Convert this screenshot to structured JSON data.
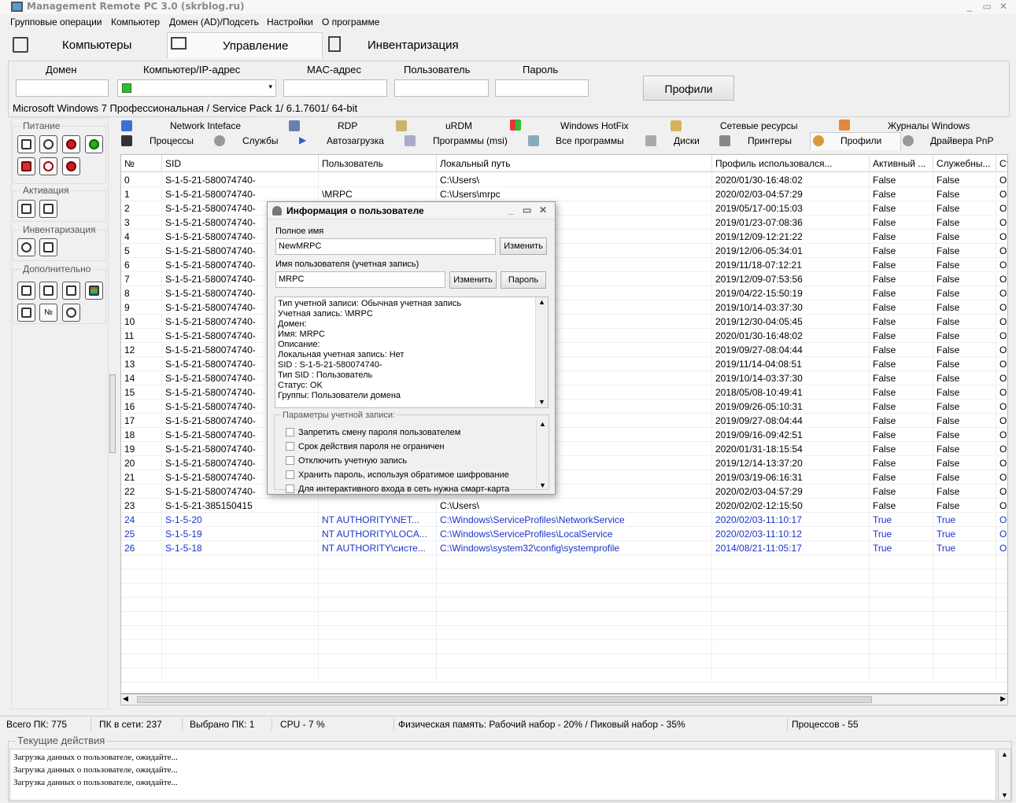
{
  "window": {
    "title": "Management Remote PC 3.0 (skrblog.ru)",
    "min": "_",
    "max": "▭",
    "close": "✕"
  },
  "menu": [
    "Групповые операции",
    "Компьютер",
    "Домен (AD)/Подсеть",
    "Настройки",
    "О программе"
  ],
  "tabs": [
    "Компьютеры",
    "Управление",
    "Инвентаризация"
  ],
  "fields": {
    "domain_label": "Домен",
    "host_label": "Компьютер/IP-адрес",
    "mac_label": "MAC-адрес",
    "user_label": "Пользователь",
    "password_label": "Пароль",
    "profiles_button": "Профили"
  },
  "os_info": "Microsoft Windows 7 Профессиональная / Service Pack 1/ 6.1.7601/ 64-bit",
  "left_groups": {
    "power": "Питание",
    "activation": "Активация",
    "inventory": "Инвентаризация",
    "extra": "Дополнительно"
  },
  "subtabs_row1": [
    "Network Inteface",
    "RDP",
    "uRDM",
    "Windows HotFix",
    "Сетевые ресурсы",
    "Журналы Windows"
  ],
  "subtabs_row2": [
    "Процессы",
    "Службы",
    "Автозагрузка",
    "Программы (msi)",
    "Все программы",
    "Диски",
    "Принтеры",
    "Профили",
    "Драйвера PnP"
  ],
  "grid": {
    "headers": [
      "№",
      "SID",
      "Пользователь",
      "Локальный путь",
      "Профиль использовался...",
      "Активный ...",
      "Служебны...",
      "Ст"
    ],
    "rows": [
      [
        "0",
        "S-1-5-21-580074740-",
        "",
        "C:\\Users\\",
        "2020/01/30-16:48:02",
        "False",
        "False",
        "O"
      ],
      [
        "1",
        "S-1-5-21-580074740-",
        "\\MRPC",
        "C:\\Users\\mrpc",
        "2020/02/03-04:57:29",
        "False",
        "False",
        "O"
      ],
      [
        "2",
        "S-1-5-21-580074740-",
        "",
        "",
        "2019/05/17-00:15:03",
        "False",
        "False",
        "O"
      ],
      [
        "3",
        "S-1-5-21-580074740-",
        "",
        "ла",
        "2019/01/23-07:08:36",
        "False",
        "False",
        "O"
      ],
      [
        "4",
        "S-1-5-21-580074740-",
        "",
        "ав",
        "2019/12/09-12:21:22",
        "False",
        "False",
        "O"
      ],
      [
        "5",
        "S-1-5-21-580074740-",
        "",
        "рий",
        "2019/12/06-05:34:01",
        "False",
        "False",
        "O"
      ],
      [
        "6",
        "S-1-5-21-580074740-",
        "",
        "",
        "2019/11/18-07:12:21",
        "False",
        "False",
        "O"
      ],
      [
        "7",
        "S-1-5-21-580074740-",
        "",
        "рия",
        "2019/12/09-07:53:56",
        "False",
        "False",
        "O"
      ],
      [
        "8",
        "S-1-5-21-580074740-",
        "",
        "",
        "2019/04/22-15:50:19",
        "False",
        "False",
        "O"
      ],
      [
        "9",
        "S-1-5-21-580074740-",
        "",
        "",
        "2019/10/14-03:37:30",
        "False",
        "False",
        "O"
      ],
      [
        "10",
        "S-1-5-21-580074740-",
        "",
        "",
        "2019/12/30-04:05:45",
        "False",
        "False",
        "O"
      ],
      [
        "11",
        "S-1-5-21-580074740-",
        "",
        "рия",
        "2020/01/30-16:48:02",
        "False",
        "False",
        "O"
      ],
      [
        "12",
        "S-1-5-21-580074740-",
        "",
        "",
        "2019/09/27-08:04:44",
        "False",
        "False",
        "O"
      ],
      [
        "13",
        "S-1-5-21-580074740-",
        "",
        "",
        "2019/11/14-04:08:51",
        "False",
        "False",
        "O"
      ],
      [
        "14",
        "S-1-5-21-580074740-",
        "",
        "",
        "2019/10/14-03:37:30",
        "False",
        "False",
        "O"
      ],
      [
        "15",
        "S-1-5-21-580074740-",
        "",
        "",
        "2018/05/08-10:49:41",
        "False",
        "False",
        "O"
      ],
      [
        "16",
        "S-1-5-21-580074740-",
        "",
        "",
        "2019/09/26-05:10:31",
        "False",
        "False",
        "O"
      ],
      [
        "17",
        "S-1-5-21-580074740-",
        "",
        "й",
        "2019/09/27-08:04:44",
        "False",
        "False",
        "O"
      ],
      [
        "18",
        "S-1-5-21-580074740-",
        "",
        "др",
        "2019/09/16-09:42:51",
        "False",
        "False",
        "O"
      ],
      [
        "19",
        "S-1-5-21-580074740-",
        "",
        "",
        "2020/01/31-18:15:54",
        "False",
        "False",
        "O"
      ],
      [
        "20",
        "S-1-5-21-580074740-",
        "",
        "",
        "2019/12/14-13:37:20",
        "False",
        "False",
        "O"
      ],
      [
        "21",
        "S-1-5-21-580074740-",
        "",
        "",
        "2019/03/19-06:16:31",
        "False",
        "False",
        "O"
      ],
      [
        "22",
        "S-1-5-21-580074740-",
        "",
        "",
        "2020/02/03-04:57:29",
        "False",
        "False",
        "O"
      ],
      [
        "23",
        "S-1-5-21-385150415",
        "",
        "C:\\Users\\",
        "2020/02/02-12:15:50",
        "False",
        "False",
        "O"
      ]
    ],
    "sys_rows": [
      [
        "24",
        "S-1-5-20",
        "NT AUTHORITY\\NET...",
        "C:\\Windows\\ServiceProfiles\\NetworkService",
        "2020/02/03-11:10:17",
        "True",
        "True",
        "O"
      ],
      [
        "25",
        "S-1-5-19",
        "NT AUTHORITY\\LOCA...",
        "C:\\Windows\\ServiceProfiles\\LocalService",
        "2020/02/03-11:10:12",
        "True",
        "True",
        "O"
      ],
      [
        "26",
        "S-1-5-18",
        "NT AUTHORITY\\систе...",
        "C:\\Windows\\system32\\config\\systemprofile",
        "2014/08/21-11:05:17",
        "True",
        "True",
        "O"
      ]
    ]
  },
  "dialog": {
    "title": "Информация о пользователе",
    "fullname_label": "Полное имя",
    "fullname_value": "NewMRPC",
    "change_button": "Изменить",
    "username_label": "Имя пользователя (учетная запись)",
    "username_value": "MRPC",
    "change_button2": "Изменить",
    "password_button": "Пароль",
    "info_lines": [
      "Тип учетной записи: Обычная учетная запись",
      "Учетная запись: \\MRPC",
      "Домен:",
      "Имя: MRPC",
      "Описание:",
      "Локальная учетная запись: Нет",
      "SID : S-1-5-21-580074740-",
      "Тип SID : Пользователь",
      "Статус: OK",
      "Группы: Пользователи домена"
    ],
    "params_label": "Параметры учетной записи:",
    "checkboxes": [
      "Запретить смену пароля пользователем",
      "Срок действия пароля не ограничен",
      "Отключить учетную запись",
      "Хранить пароль, используя обратимое шифрование",
      "Для интерактивного входа в сеть нужна смарт-карта"
    ]
  },
  "status": {
    "total": "Всего ПК: 775",
    "online": "ПК в сети: 237",
    "selected": "Выбрано ПК: 1",
    "cpu": "CPU - 7 %",
    "memory": "Физическая память: Рабочий набор - 20% / Пиковый набор - 35%",
    "processes": "Процессов - 55"
  },
  "actions": {
    "title": "Текущие действия",
    "log": [
      "Загрузка данных о пользователе, ожидайте...",
      "Загрузка данных о пользователе, ожидайте...",
      "Загрузка данных о пользователе, ожидайте..."
    ]
  },
  "colors": {
    "system_row_text": "#1a33c8"
  }
}
